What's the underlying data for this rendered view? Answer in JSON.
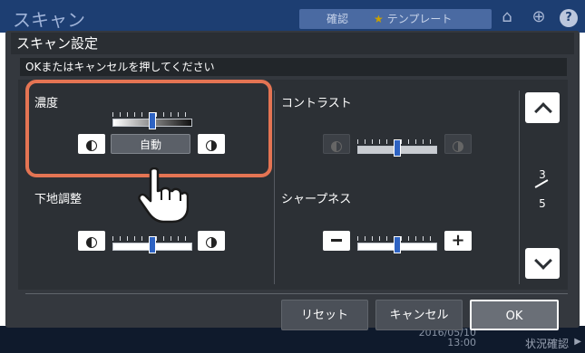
{
  "background": {
    "title": "スキャン",
    "tab_confirm": "確認",
    "tab_template": "テンプレート",
    "home_icon": "home-icon",
    "globe_icon": "globe-icon",
    "help_label": "?",
    "datetime_date": "2016/05/10",
    "datetime_time": "13:00",
    "status_confirm": "状況確認"
  },
  "dialog": {
    "title": "スキャン設定",
    "message": "OKまたはキャンセルを押してください"
  },
  "settings": {
    "density": {
      "label": "濃度",
      "auto_label": "自動",
      "level": 0.5
    },
    "contrast": {
      "label": "コントラスト",
      "level": 0.5
    },
    "background_adjust": {
      "label": "下地調整",
      "level": 0.5
    },
    "sharpness": {
      "label": "シャープネス",
      "level": 0.5
    }
  },
  "pager": {
    "current": "3",
    "total": "5"
  },
  "actions": {
    "reset": "リセット",
    "cancel": "キャンセル",
    "ok": "OK"
  }
}
